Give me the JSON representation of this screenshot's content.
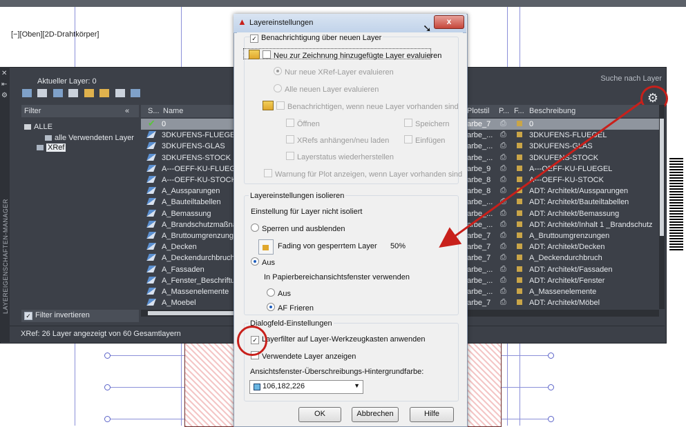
{
  "app": {
    "viewport_label": "[−][Oben][2D-Drahtkörper]"
  },
  "palette": {
    "title": "LAYEREIGENSCHAFTEN-MANAGER",
    "current_layer": "Aktueller Layer: 0",
    "search_placeholder": "Suche nach Layer",
    "filter_header": "Filter",
    "filter_collapse": "«",
    "filters": [
      {
        "label": "ALLE"
      },
      {
        "label": "alle Verwendeten Layer"
      },
      {
        "label": "XRef"
      }
    ],
    "filter_invert_label": "Filter invertieren",
    "columns": {
      "status": "S...",
      "name": "Name",
      "plotstyle": "Plotstil",
      "plot": "P...",
      "freeze": "F...",
      "description": "Beschreibung"
    },
    "status_text": "XRef: 26 Layer angezeigt von 60 Gesamtlayern",
    "layers": [
      {
        "name": "0",
        "plot": "arbe_7",
        "desc": "0"
      },
      {
        "name": "3DKUFENS-FLUEGEL",
        "plot": "arbe_...",
        "desc": "3DKUFENS-FLUEGEL"
      },
      {
        "name": "3DKUFENS-GLAS",
        "plot": "arbe_...",
        "desc": "3DKUFENS-GLAS"
      },
      {
        "name": "3DKUFENS-STOCK",
        "plot": "arbe_...",
        "desc": "3DKUFENS-STOCK"
      },
      {
        "name": "A---OEFF-KU-FLUEGEL",
        "plot": "arbe_9",
        "desc": "A---OEFF-KU-FLUEGEL"
      },
      {
        "name": "A---OEFF-KU-STOCK",
        "plot": "arbe_8",
        "desc": "A---OEFF-KU-STOCK"
      },
      {
        "name": "A_Aussparungen",
        "plot": "arbe_8",
        "desc": "ADT: Architekt/Aussparungen"
      },
      {
        "name": "A_Bauteiltabellen",
        "plot": "arbe_...",
        "desc": "ADT: Architekt/Bauteiltabellen"
      },
      {
        "name": "A_Bemassung",
        "plot": "arbe_...",
        "desc": "ADT: Architekt/Bemassung"
      },
      {
        "name": "A_Brandschutzmaßnal",
        "plot": "arbe_...",
        "desc": "ADT:  Architekt/Inhalt 1 _Brandschutz"
      },
      {
        "name": "A_Bruttoumgrenzunge",
        "plot": "arbe_7",
        "desc": "A_Bruttoumgrenzungen"
      },
      {
        "name": "A_Decken",
        "plot": "arbe_7",
        "desc": "ADT: Architekt/Decken"
      },
      {
        "name": "A_Deckendurchbruch",
        "plot": "arbe_7",
        "desc": "A_Deckendurchbruch"
      },
      {
        "name": "A_Fassaden",
        "plot": "arbe_...",
        "desc": "ADT: Architekt/Fassaden"
      },
      {
        "name": "A_Fenster_Beschriftun",
        "plot": "arbe_...",
        "desc": "ADT: Architekt/Fenster"
      },
      {
        "name": "A_Massenelemente",
        "plot": "arbe_...",
        "desc": "A_Massenelemente"
      },
      {
        "name": "A_Moebel",
        "plot": "arbe_7",
        "desc": "ADT: Architekt/Möbel"
      }
    ]
  },
  "dialog": {
    "title": "Layereinstellungen",
    "close_label": "x",
    "notify_new_layers": "Benachrichtigung über neuen Layer",
    "evaluate_new_layers": "Neu zur Zeichnung hinzugefügte Layer evaluieren",
    "only_xref": "Nur neue XRef-Layer evaluieren",
    "all_new": "Alle neuen Layer evaluieren",
    "notify_when_present": "Benachrichtigen, wenn neue Layer vorhanden sind",
    "open": "Öffnen",
    "save": "Speichern",
    "attach_xrefs": "XRefs anhängen/neu laden",
    "insert": "Einfügen",
    "restore_state": "Layerstatus wiederherstellen",
    "plot_warning": "Warnung für Plot anzeigen, wenn Layer vorhanden sind",
    "isolate_group": "Layereinstellungen isolieren",
    "isolate_setting": "Einstellung für Layer nicht isoliert",
    "lock_fade": "Sperren und ausblenden",
    "fading_label": "Fading von gesperrtem Layer",
    "fading_value": "50%",
    "off": "Aus",
    "paper_space": "In Papierbereichansichtsfenster verwenden",
    "ps_off": "Aus",
    "ps_freeze": "AF Frieren",
    "dialog_group": "Dialogfeld-Einstellungen",
    "apply_filter": "Layerfilter auf Layer-Werkzeugkasten anwenden",
    "show_used": "Verwendete Layer anzeigen",
    "bg_color_label": "Ansichtsfenster-Überschreibungs-Hintergrundfarbe:",
    "bg_color_value": "106,182,226",
    "ok": "OK",
    "cancel": "Abbrechen",
    "help": "Hilfe"
  },
  "colors": {
    "palette_bg": "#3c4048",
    "annotation_red": "#c8201b",
    "selection_bg": "#8f959e",
    "bg_swatch": "#6ab6e2"
  }
}
